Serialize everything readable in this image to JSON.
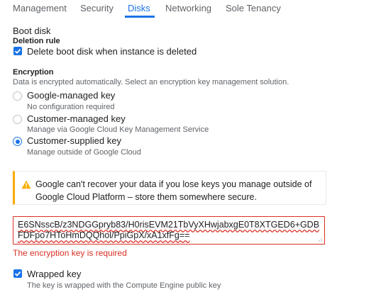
{
  "tabs": [
    {
      "label": "Management"
    },
    {
      "label": "Security"
    },
    {
      "label": "Disks"
    },
    {
      "label": "Networking"
    },
    {
      "label": "Sole Tenancy"
    }
  ],
  "accent_color": "#1a73e8",
  "boot_disk": {
    "title": "Boot disk",
    "deletion_rule_label": "Deletion rule",
    "delete_checkbox": {
      "label": "Delete boot disk when instance is deleted",
      "checked": true
    }
  },
  "encryption": {
    "title": "Encryption",
    "description": "Data is encrypted automatically. Select an encryption key management solution.",
    "options": [
      {
        "label": "Google-managed key",
        "sub": "No configuration required",
        "selected": false
      },
      {
        "label": "Customer-managed key",
        "sub": "Manage via Google Cloud Key Management Service",
        "selected": false
      },
      {
        "label": "Customer-supplied key",
        "sub": "Manage outside of Google Cloud",
        "selected": true
      }
    ]
  },
  "warning": {
    "icon": "warning-icon",
    "text": "Google can't recover your data if you lose keys you manage outside of Google Cloud Platform – store them somewhere secure."
  },
  "key_input": {
    "value": "E6SNsscB/z3NDGGpryb83/H0risEVM21TbVyXHwjabxgE0T8XTGED6+GDBFDFpo7HToHmDQQhol/PpiGpX/xA1xfFg=="
  },
  "error": {
    "text": "The encryption key is required"
  },
  "wrapped_key": {
    "label": "Wrapped key",
    "checked": true,
    "sub": "The key is wrapped with the Compute Engine public key"
  }
}
